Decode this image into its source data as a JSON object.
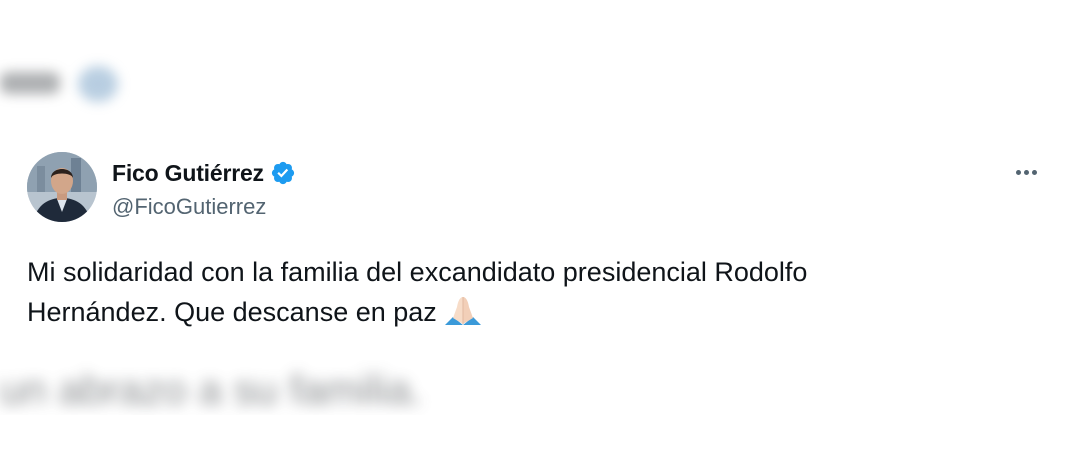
{
  "tweet": {
    "display_name": "Fico Gutiérrez",
    "handle": "@FicoGutierrez",
    "text_line1": "Mi solidaridad con la familia del excandidato presidencial Rodolfo",
    "text_line2": "Hernández. Que descanse en paz",
    "emoji": "praying-hands-emoji",
    "verified_color": "#1d9bf0"
  },
  "background": {
    "blurred_text_bottom": "un abrazo a su familia."
  },
  "icons": {
    "verified": "verified-badge-icon",
    "more": "more-options-icon"
  }
}
